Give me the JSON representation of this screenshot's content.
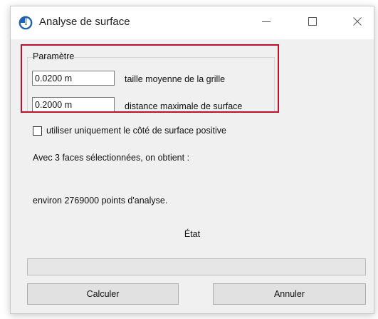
{
  "window": {
    "title": "Analyse de surface"
  },
  "group": {
    "label": "Paramètre"
  },
  "fields": {
    "grid_size": {
      "value": "0.0200 m",
      "label": "taille moyenne de la grille"
    },
    "max_distance": {
      "value": "0.2000 m",
      "label": "distance maximale de surface"
    }
  },
  "option": {
    "positive_side_only_label": "utiliser uniquement le côté de surface positive",
    "checked": false
  },
  "info": {
    "faces_text": "Avec 3 faces sélectionnées, on obtient :",
    "points_text": "environ 2769000 points d'analyse."
  },
  "status": {
    "label": "État",
    "progress": 0
  },
  "buttons": {
    "calculate": "Calculer",
    "cancel": "Annuler"
  },
  "colors": {
    "highlight": "#c0102a",
    "icon_blue": "#1c62b9"
  },
  "icons": {
    "app": "surface-analysis-icon",
    "minimize": "minimize-icon",
    "maximize": "maximize-icon",
    "close": "close-icon"
  }
}
